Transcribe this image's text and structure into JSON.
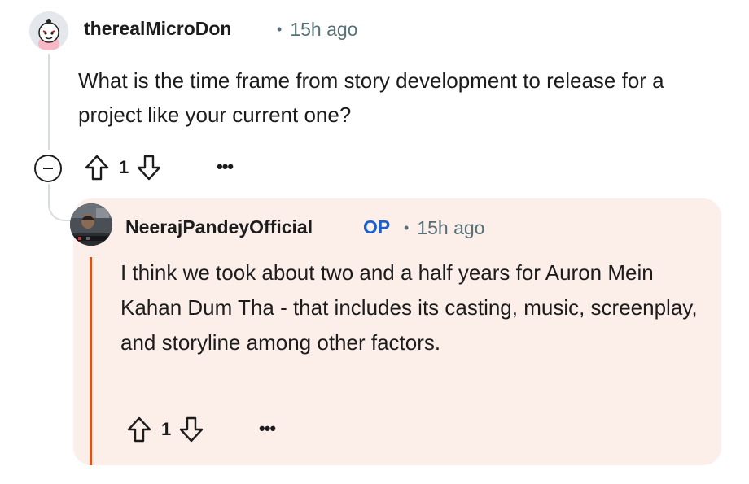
{
  "comment": {
    "username": "therealMicroDon",
    "time": "15h ago",
    "body": "What is the time frame from story development to release for a project like your current one?",
    "votes": "1",
    "more": "•••"
  },
  "reply": {
    "username": "NeerajPandeyOfficial",
    "badge": "OP",
    "time": "15h ago",
    "body": "I think we took about two and a half years for Auron Mein Kahan Dum Tha - that includes its casting, music, screenplay, and storyline among other factors.",
    "votes": "1",
    "more": "•••"
  },
  "separator": "•",
  "colors": {
    "reply_background": "#fcefea",
    "reply_border": "#d9531e",
    "op_badge": "#1a5fd0",
    "meta_text": "#576f76"
  },
  "icons": {
    "upvote": "upvote-arrow-icon",
    "downvote": "downvote-arrow-icon",
    "collapse": "collapse-minus-icon",
    "more": "more-options-icon"
  }
}
